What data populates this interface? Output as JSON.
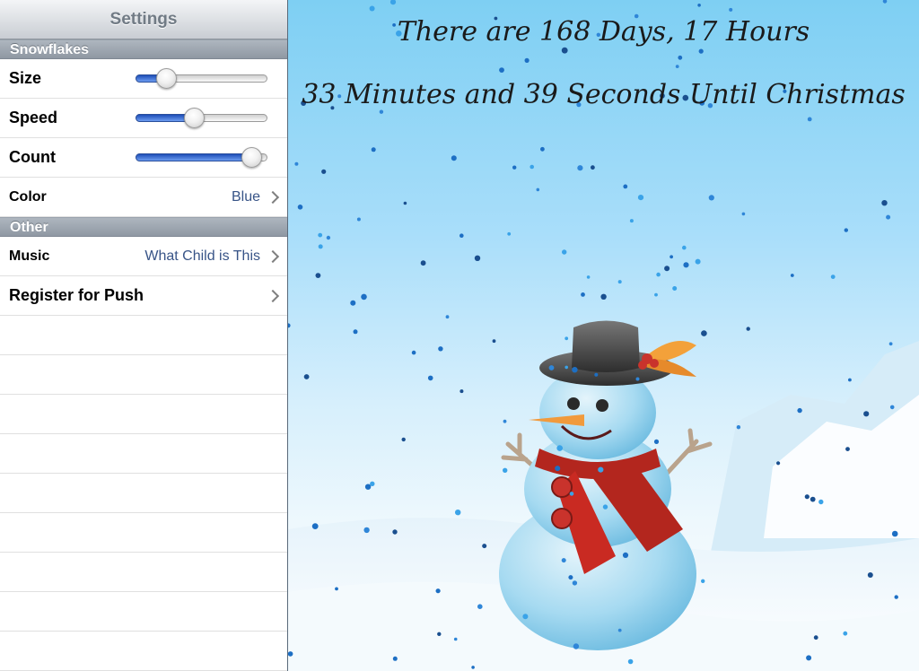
{
  "navbar": {
    "title": "Settings"
  },
  "sections": [
    {
      "header": "Snowflakes"
    },
    {
      "header": "Other"
    }
  ],
  "snowflakes": {
    "size": {
      "label": "Size",
      "value": 0.18
    },
    "speed": {
      "label": "Speed",
      "value": 0.43
    },
    "count": {
      "label": "Count",
      "value": 0.94
    },
    "color": {
      "label": "Color",
      "value": "Blue"
    }
  },
  "other": {
    "music": {
      "label": "Music",
      "value": "What Child is This"
    },
    "push": {
      "label": "Register for Push"
    }
  },
  "countdown": {
    "line1": "There are 168 Days, 17 Hours",
    "line2": "33 Minutes and 39 Seconds Until Christmas"
  },
  "colors": {
    "accent_blue": "#2b63d0",
    "detail_text": "#385487",
    "sky": "#7ecff3"
  },
  "icons": [
    "chevron-right-icon",
    "snowman-illustration",
    "snowflake-dot"
  ]
}
